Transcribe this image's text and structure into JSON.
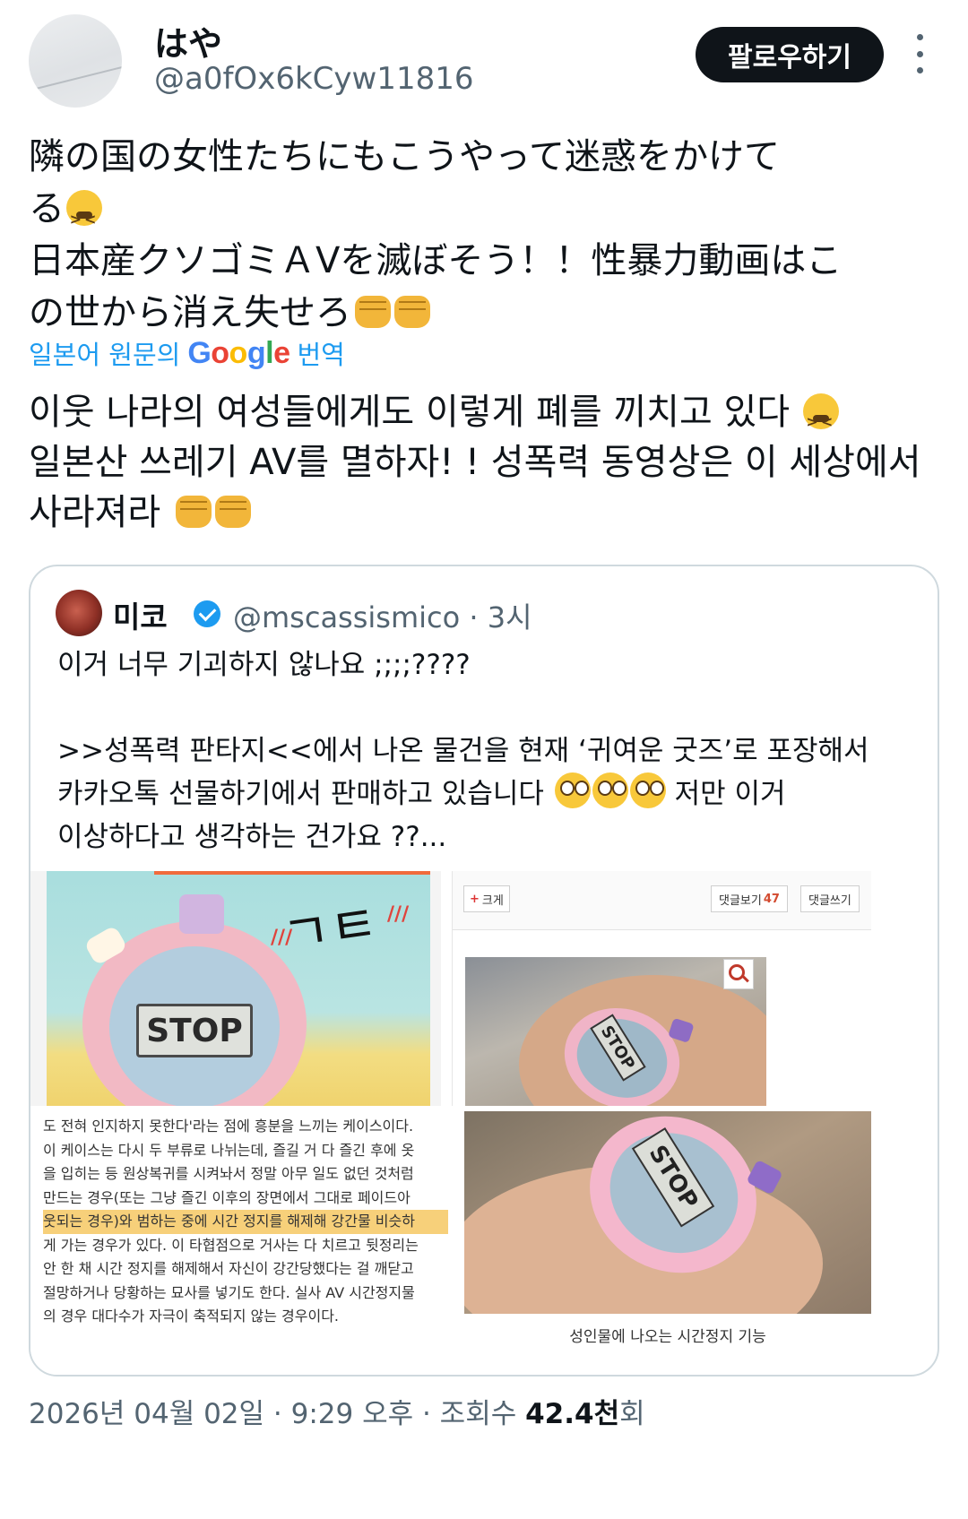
{
  "author": {
    "display_name": "はや",
    "handle": "@a0fOx6kCyw11816",
    "follow_label": "팔로우하기"
  },
  "tweet": {
    "lines": [
      "隣の国の女性たちにもこうやって迷惑をかけて",
      "る",
      "日本産クソゴミＡVを滅ぼそう！！性暴力動画はこ",
      "の世から消え失せろ"
    ],
    "emojis": [
      "persevering-face-emoji",
      "oncoming-fist-emoji",
      "oncoming-fist-emoji"
    ]
  },
  "translation": {
    "prefix": "일본어 원문의",
    "brand": "Google",
    "suffix": "번역",
    "lines": [
      "이웃 나라의 여성들에게도 이렇게 폐를 끼치고 있다",
      "일본산 쓰레기 AV를 멸하자! ! 성폭력 동영상은 이 세상에서",
      "사라져라"
    ]
  },
  "quote": {
    "display_name": "미코",
    "handle": "@mscassismico · 3시",
    "lines": [
      "이거 너무 기괴하지 않나요 ;;;;????",
      "",
      ">>성폭력 판타지<<에서 나온 물건을 현재 ‘귀여운 굿즈’로 포장해서",
      "카카오톡 선물하기에서 판매하고 있습니다",
      "저만 이거",
      "이상하다고 생각하는 건가요 ??..."
    ],
    "media": {
      "stop_label": "STOP",
      "drawing_text": "ㄱㅌ",
      "zoom_label": "크게",
      "comments_view_label": "댓글보기",
      "comments_count": "47",
      "comment_write_label": "댓글쓰기",
      "caption": "성인물에 나오는 시간정지 기능",
      "article_lines": [
        "도 전혀 인지하지 못한다'라는 점에 흥분을 느끼는 케이스이다.",
        "이 케이스는 다시 두 부류로 나뉘는데, 즐길 거 다 즐긴 후에 옷",
        "을 입히는 등 원상복귀를 시켜놔서 정말 아무 일도 없던 것처럼",
        "만드는 경우(또는 그냥 즐긴 이후의 장면에서 그대로 페이드아",
        "웃되는 경우)와 범하는 중에 시간 정지를 해제해 강간물 비슷하",
        "게 가는 경우가 있다. 이 타협점으로 거사는 다 치르고 뒷정리는",
        "안 한 채 시간 정지를 해제해서 자신이 강간당했다는 걸 깨닫고",
        "절망하거나 당황하는 묘사를 넣기도 한다. 실사 AV 시간정지물",
        "의 경우 대다수가 자극이 축적되지 않는 경우이다."
      ]
    }
  },
  "meta": {
    "timestamp": "2026년 04월 02일 · 9:29 오후 · 조회수",
    "views": "42.4천",
    "views_suffix": "회"
  }
}
